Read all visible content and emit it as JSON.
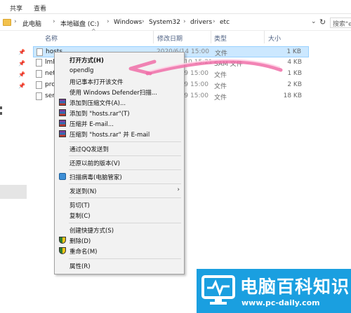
{
  "ribbon": {
    "tabs": [
      "共享",
      "查看"
    ]
  },
  "address": {
    "crumbs": [
      "此电脑",
      "本地磁盘 (C:)",
      "Windows",
      "System32",
      "drivers",
      "etc"
    ],
    "search_placeholder": "搜索\"e"
  },
  "columns": {
    "name": "名称",
    "date": "修改日期",
    "type": "类型",
    "size": "大小"
  },
  "files": [
    {
      "name": "hosts",
      "date": "2020/6/14 15:00",
      "type": "文件",
      "size": "1 KB",
      "selected": true
    },
    {
      "name": "lmh",
      "date": "2019/12/10 15:21",
      "type": "SAM 文件",
      "size": "4 KB"
    },
    {
      "name": "net",
      "date": "2019/3/19 15:00",
      "type": "文件",
      "size": "1 KB"
    },
    {
      "name": "pro",
      "date": "2019/3/19 15:00",
      "type": "文件",
      "size": "2 KB"
    },
    {
      "name": "ser",
      "date": "2019/3/19 15:00",
      "type": "文件",
      "size": "18 KB"
    }
  ],
  "menu": {
    "items": [
      {
        "label": "打开方式(H)",
        "bold": true
      },
      {
        "label": "opendlg"
      },
      {
        "label": "用记事本打开该文件"
      },
      {
        "label": "使用 Windows Defender扫描..."
      },
      {
        "label": "添加到压缩文件(A)...",
        "icon": "winrar-icon"
      },
      {
        "label": "添加到 \"hosts.rar\"(T)",
        "icon": "winrar-icon"
      },
      {
        "label": "压缩并 E-mail...",
        "icon": "winrar-icon"
      },
      {
        "label": "压缩到 \"hosts.rar\" 并 E-mail",
        "icon": "winrar-icon"
      },
      {
        "label": "通过QQ发送到"
      },
      {
        "label": "还原以前的版本(V)"
      },
      {
        "label": "扫描病毒(电脑管家)",
        "icon": "shield-icon"
      },
      {
        "label": "发送到(N)",
        "submenu": true
      },
      {
        "label": "剪切(T)"
      },
      {
        "label": "复制(C)"
      },
      {
        "label": "创建快捷方式(S)"
      },
      {
        "label": "删除(D)",
        "icon": "uac-shield-icon"
      },
      {
        "label": "重命名(M)",
        "icon": "uac-shield-icon"
      },
      {
        "label": "属性(R)"
      }
    ]
  },
  "watermark": {
    "title": "电脑百科知识",
    "url": "www.pc-daily.com"
  },
  "colors": {
    "accent": "#1a9fe0",
    "selection": "#cce8ff",
    "annotation": "#f06fa8"
  }
}
